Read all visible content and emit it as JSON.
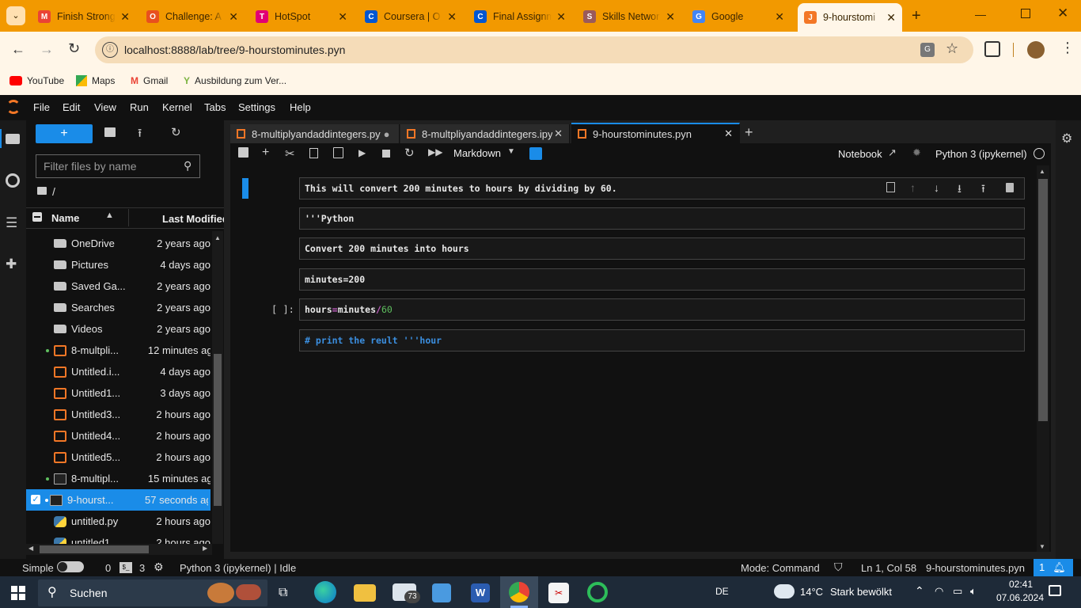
{
  "browser": {
    "tabs": [
      {
        "title": "Finish Strong",
        "fav_color": "#ea4335",
        "fav_char": "M"
      },
      {
        "title": "Challenge: A",
        "fav_color": "#e8501e",
        "fav_char": "O"
      },
      {
        "title": "HotSpot",
        "fav_color": "#e20074",
        "fav_char": "T"
      },
      {
        "title": "Coursera | O",
        "fav_color": "#0056d2",
        "fav_char": "C"
      },
      {
        "title": "Final Assignm",
        "fav_color": "#0056d2",
        "fav_char": "C"
      },
      {
        "title": "Skills Networ",
        "fav_color": "#9a5a5a",
        "fav_char": "S"
      },
      {
        "title": "Google",
        "fav_color": "#4285f4",
        "fav_char": "G"
      },
      {
        "title": "9-hourstomi",
        "fav_color": "#f37726",
        "fav_char": "J"
      }
    ],
    "url": "localhost:8888/lab/tree/9-hourstominutes.pyn",
    "bookmarks": [
      "YouTube",
      "Maps",
      "Gmail",
      "Ausbildung zum Ver..."
    ]
  },
  "menu": [
    "File",
    "Edit",
    "View",
    "Run",
    "Kernel",
    "Tabs",
    "Settings",
    "Help"
  ],
  "filebrowser": {
    "new_label": "+",
    "filter_placeholder": "Filter files by name",
    "path": "/",
    "col_name": "Name",
    "col_modified": "Last Modified",
    "files": [
      {
        "name": "OneDrive",
        "modified": "2 years ago",
        "type": "folder"
      },
      {
        "name": "Pictures",
        "modified": "4 days ago",
        "type": "folder"
      },
      {
        "name": "Saved Ga...",
        "modified": "2 years ago",
        "type": "folder"
      },
      {
        "name": "Searches",
        "modified": "2 years ago",
        "type": "folder"
      },
      {
        "name": "Videos",
        "modified": "2 years ago",
        "type": "folder"
      },
      {
        "name": "8-multpli...",
        "modified": "12 minutes ago",
        "type": "notebook"
      },
      {
        "name": "Untitled.i...",
        "modified": "4 days ago",
        "type": "notebook"
      },
      {
        "name": "Untitled1...",
        "modified": "3 days ago",
        "type": "notebook"
      },
      {
        "name": "Untitled3...",
        "modified": "2 hours ago",
        "type": "notebook"
      },
      {
        "name": "Untitled4...",
        "modified": "2 hours ago",
        "type": "notebook"
      },
      {
        "name": "Untitled5...",
        "modified": "2 hours ago",
        "type": "notebook"
      },
      {
        "name": "8-multipl...",
        "modified": "15 minutes ago",
        "type": "file"
      },
      {
        "name": "9-hourst...",
        "modified": "57 seconds ago",
        "type": "file"
      },
      {
        "name": "untitled.py",
        "modified": "2 hours ago",
        "type": "python"
      },
      {
        "name": "untitled1",
        "modified": "2 hours ago",
        "type": "python"
      }
    ]
  },
  "doc_tabs": [
    {
      "title": "8-multiplyandaddintegers.py",
      "marker": "●"
    },
    {
      "title": "8-multpliyandaddintegers.ipy",
      "marker": "✕"
    },
    {
      "title": "9-hourstominutes.pyn",
      "marker": "✕"
    }
  ],
  "toolbar": {
    "cell_type": "Markdown",
    "notebook_link": "Notebook",
    "kernel": "Python 3 (ipykernel)"
  },
  "cells": [
    {
      "prompt": "",
      "text": "This will convert 200 minutes to hours by dividing by 60."
    },
    {
      "prompt": "",
      "text": "'''Python"
    },
    {
      "prompt": "",
      "text": "Convert 200 minutes into hours"
    },
    {
      "prompt": "",
      "text": "minutes=200"
    },
    {
      "prompt": "[ ]:",
      "code": {
        "a": "hours",
        "op": "=",
        "b": "minutes",
        "div": "/",
        "num": "60"
      }
    },
    {
      "prompt": "",
      "text": "# print the reult '''hour"
    }
  ],
  "status": {
    "mode_label": "Simple",
    "terminals": "0",
    "kernels": "3",
    "kernel_status": "Python 3 (ipykernel) | Idle",
    "command_mode": "Mode: Command",
    "position": "Ln 1, Col 58",
    "filename": "9-hourstominutes.pyn",
    "notifications": "1"
  },
  "taskbar": {
    "search": "Suchen",
    "mail_badge": "73",
    "lang": "DE",
    "weather_temp": "14°C",
    "weather_text": "Stark bewölkt",
    "time": "02:41",
    "date": "07.06.2024"
  },
  "colors": {
    "browser_accent": "#f29900",
    "jupyter_orange": "#f37726",
    "selection": "#1a8ce8",
    "code_green": "#5fbf5f",
    "code_magenta": "#c45ec4",
    "comment_blue": "#3b8fe0"
  }
}
